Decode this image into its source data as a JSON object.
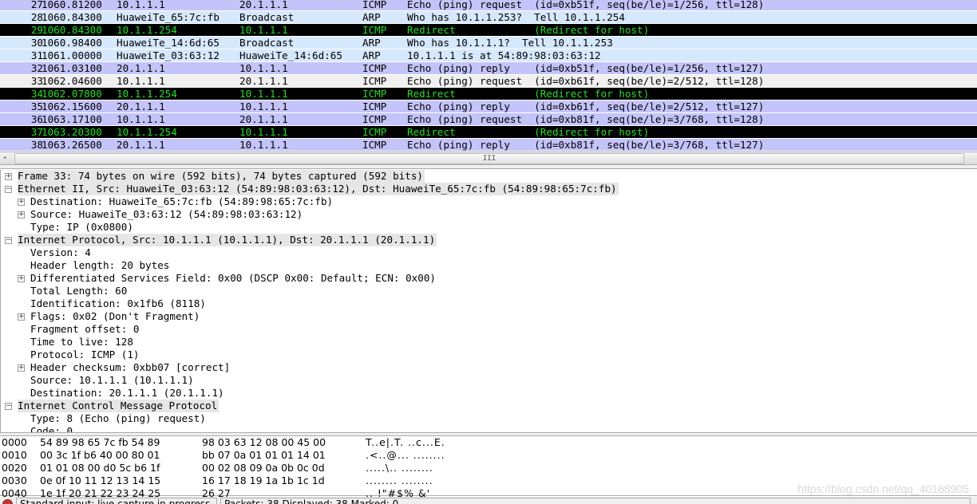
{
  "colors": {
    "icmp_bg": "#c4c4fa",
    "arp_bg": "#d6e8fc",
    "redirect_bg": "#000000",
    "redirect_fg": "#1ee01e",
    "selected_bg": "#f0f0f0"
  },
  "packets": [
    {
      "no": "27",
      "time": "1060.81200",
      "src": "10.1.1.1",
      "dst": "20.1.1.1",
      "proto": "ICMP",
      "info": "Echo (ping) request  (id=0xb51f, seq(be/le)=1/256, ttl=128)",
      "style": "icmp"
    },
    {
      "no": "28",
      "time": "1060.84300",
      "src": "HuaweiTe_65:7c:fb",
      "dst": "Broadcast",
      "proto": "ARP",
      "info": "Who has 10.1.1.253?  Tell 10.1.1.254",
      "style": "arp"
    },
    {
      "no": "29",
      "time": "1060.84300",
      "src": "10.1.1.254",
      "dst": "10.1.1.1",
      "proto": "ICMP",
      "info": "Redirect             (Redirect for host)",
      "style": "redirect"
    },
    {
      "no": "30",
      "time": "1060.98400",
      "src": "HuaweiTe_14:6d:65",
      "dst": "Broadcast",
      "proto": "ARP",
      "info": "Who has 10.1.1.1?  Tell 10.1.1.253",
      "style": "arp"
    },
    {
      "no": "31",
      "time": "1061.00000",
      "src": "HuaweiTe_03:63:12",
      "dst": "HuaweiTe_14:6d:65",
      "proto": "ARP",
      "info": "10.1.1.1 is at 54:89:98:03:63:12",
      "style": "arp"
    },
    {
      "no": "32",
      "time": "1061.03100",
      "src": "20.1.1.1",
      "dst": "10.1.1.1",
      "proto": "ICMP",
      "info": "Echo (ping) reply    (id=0xb51f, seq(be/le)=1/256, ttl=127)",
      "style": "icmp"
    },
    {
      "no": "33",
      "time": "1062.04600",
      "src": "10.1.1.1",
      "dst": "20.1.1.1",
      "proto": "ICMP",
      "info": "Echo (ping) request  (id=0xb61f, seq(be/le)=2/512, ttl=128)",
      "style": "selected"
    },
    {
      "no": "34",
      "time": "1062.07800",
      "src": "10.1.1.254",
      "dst": "10.1.1.1",
      "proto": "ICMP",
      "info": "Redirect             (Redirect for host)",
      "style": "redirect"
    },
    {
      "no": "35",
      "time": "1062.15600",
      "src": "20.1.1.1",
      "dst": "10.1.1.1",
      "proto": "ICMP",
      "info": "Echo (ping) reply    (id=0xb61f, seq(be/le)=2/512, ttl=127)",
      "style": "icmp"
    },
    {
      "no": "36",
      "time": "1063.17100",
      "src": "10.1.1.1",
      "dst": "20.1.1.1",
      "proto": "ICMP",
      "info": "Echo (ping) request  (id=0xb81f, seq(be/le)=3/768, ttl=128)",
      "style": "icmp"
    },
    {
      "no": "37",
      "time": "1063.20300",
      "src": "10.1.1.254",
      "dst": "10.1.1.1",
      "proto": "ICMP",
      "info": "Redirect             (Redirect for host)",
      "style": "redirect"
    },
    {
      "no": "38",
      "time": "1063.26500",
      "src": "20.1.1.1",
      "dst": "10.1.1.1",
      "proto": "ICMP",
      "info": "Echo (ping) reply    (id=0xb81f, seq(be/le)=3/768, ttl=127)",
      "style": "icmp"
    }
  ],
  "scrollbar": {
    "thumb_grip": "III",
    "left_arrow": "◂"
  },
  "details": [
    {
      "level": 0,
      "exp": "+",
      "hdr": true,
      "text": "Frame 33: 74 bytes on wire (592 bits), 74 bytes captured (592 bits)"
    },
    {
      "level": 0,
      "exp": "-",
      "hdr": true,
      "text": "Ethernet II, Src: HuaweiTe_03:63:12 (54:89:98:03:63:12), Dst: HuaweiTe_65:7c:fb (54:89:98:65:7c:fb)"
    },
    {
      "level": 1,
      "exp": "+",
      "text": "Destination: HuaweiTe_65:7c:fb (54:89:98:65:7c:fb)"
    },
    {
      "level": 1,
      "exp": "+",
      "text": "Source: HuaweiTe_03:63:12 (54:89:98:03:63:12)"
    },
    {
      "level": 1,
      "exp": "",
      "text": "Type: IP (0x0800)"
    },
    {
      "level": 0,
      "exp": "-",
      "hdr": true,
      "text": "Internet Protocol, Src: 10.1.1.1 (10.1.1.1), Dst: 20.1.1.1 (20.1.1.1)"
    },
    {
      "level": 1,
      "exp": "",
      "text": "Version: 4"
    },
    {
      "level": 1,
      "exp": "",
      "text": "Header length: 20 bytes"
    },
    {
      "level": 1,
      "exp": "+",
      "text": "Differentiated Services Field: 0x00 (DSCP 0x00: Default; ECN: 0x00)"
    },
    {
      "level": 1,
      "exp": "",
      "text": "Total Length: 60"
    },
    {
      "level": 1,
      "exp": "",
      "text": "Identification: 0x1fb6 (8118)"
    },
    {
      "level": 1,
      "exp": "+",
      "text": "Flags: 0x02 (Don't Fragment)"
    },
    {
      "level": 1,
      "exp": "",
      "text": "Fragment offset: 0"
    },
    {
      "level": 1,
      "exp": "",
      "text": "Time to live: 128"
    },
    {
      "level": 1,
      "exp": "",
      "text": "Protocol: ICMP (1)"
    },
    {
      "level": 1,
      "exp": "+",
      "text": "Header checksum: 0xbb07 [correct]"
    },
    {
      "level": 1,
      "exp": "",
      "text": "Source: 10.1.1.1 (10.1.1.1)"
    },
    {
      "level": 1,
      "exp": "",
      "text": "Destination: 20.1.1.1 (20.1.1.1)"
    },
    {
      "level": 0,
      "exp": "-",
      "hdr": true,
      "text": "Internet Control Message Protocol"
    },
    {
      "level": 1,
      "exp": "",
      "text": "Type: 8 (Echo (ping) request)"
    },
    {
      "level": 1,
      "exp": "",
      "text": "Code: 0"
    }
  ],
  "hex": [
    {
      "off": "0000",
      "b1": "54 89 98 65 7c fb 54 89",
      "b2": "98 03 63 12 08 00 45 00",
      "ascii": "T..e|.T. ..c...E."
    },
    {
      "off": "0010",
      "b1": "00 3c 1f b6 40 00 80 01",
      "b2": "bb 07 0a 01 01 01 14 01",
      "ascii": ".<..@... ........"
    },
    {
      "off": "0020",
      "b1": "01 01 08 00 d0 5c b6 1f",
      "b2": "00 02 08 09 0a 0b 0c 0d",
      "ascii": ".....\\.. ........"
    },
    {
      "off": "0030",
      "b1": "0e 0f 10 11 12 13 14 15",
      "b2": "16 17 18 19 1a 1b 1c 1d",
      "ascii": "........ ........"
    },
    {
      "off": "0040",
      "b1": "1e 1f 20 21 22 23 24 25",
      "b2": "26 27",
      "ascii": ".. !\"#$% &'"
    }
  ],
  "watermark": "https://blog.csdn.net/qq_40168905",
  "status": {
    "left": "Standard input: live capture in progress",
    "right": "Packets: 38 Displayed: 38 Marked: 0"
  }
}
